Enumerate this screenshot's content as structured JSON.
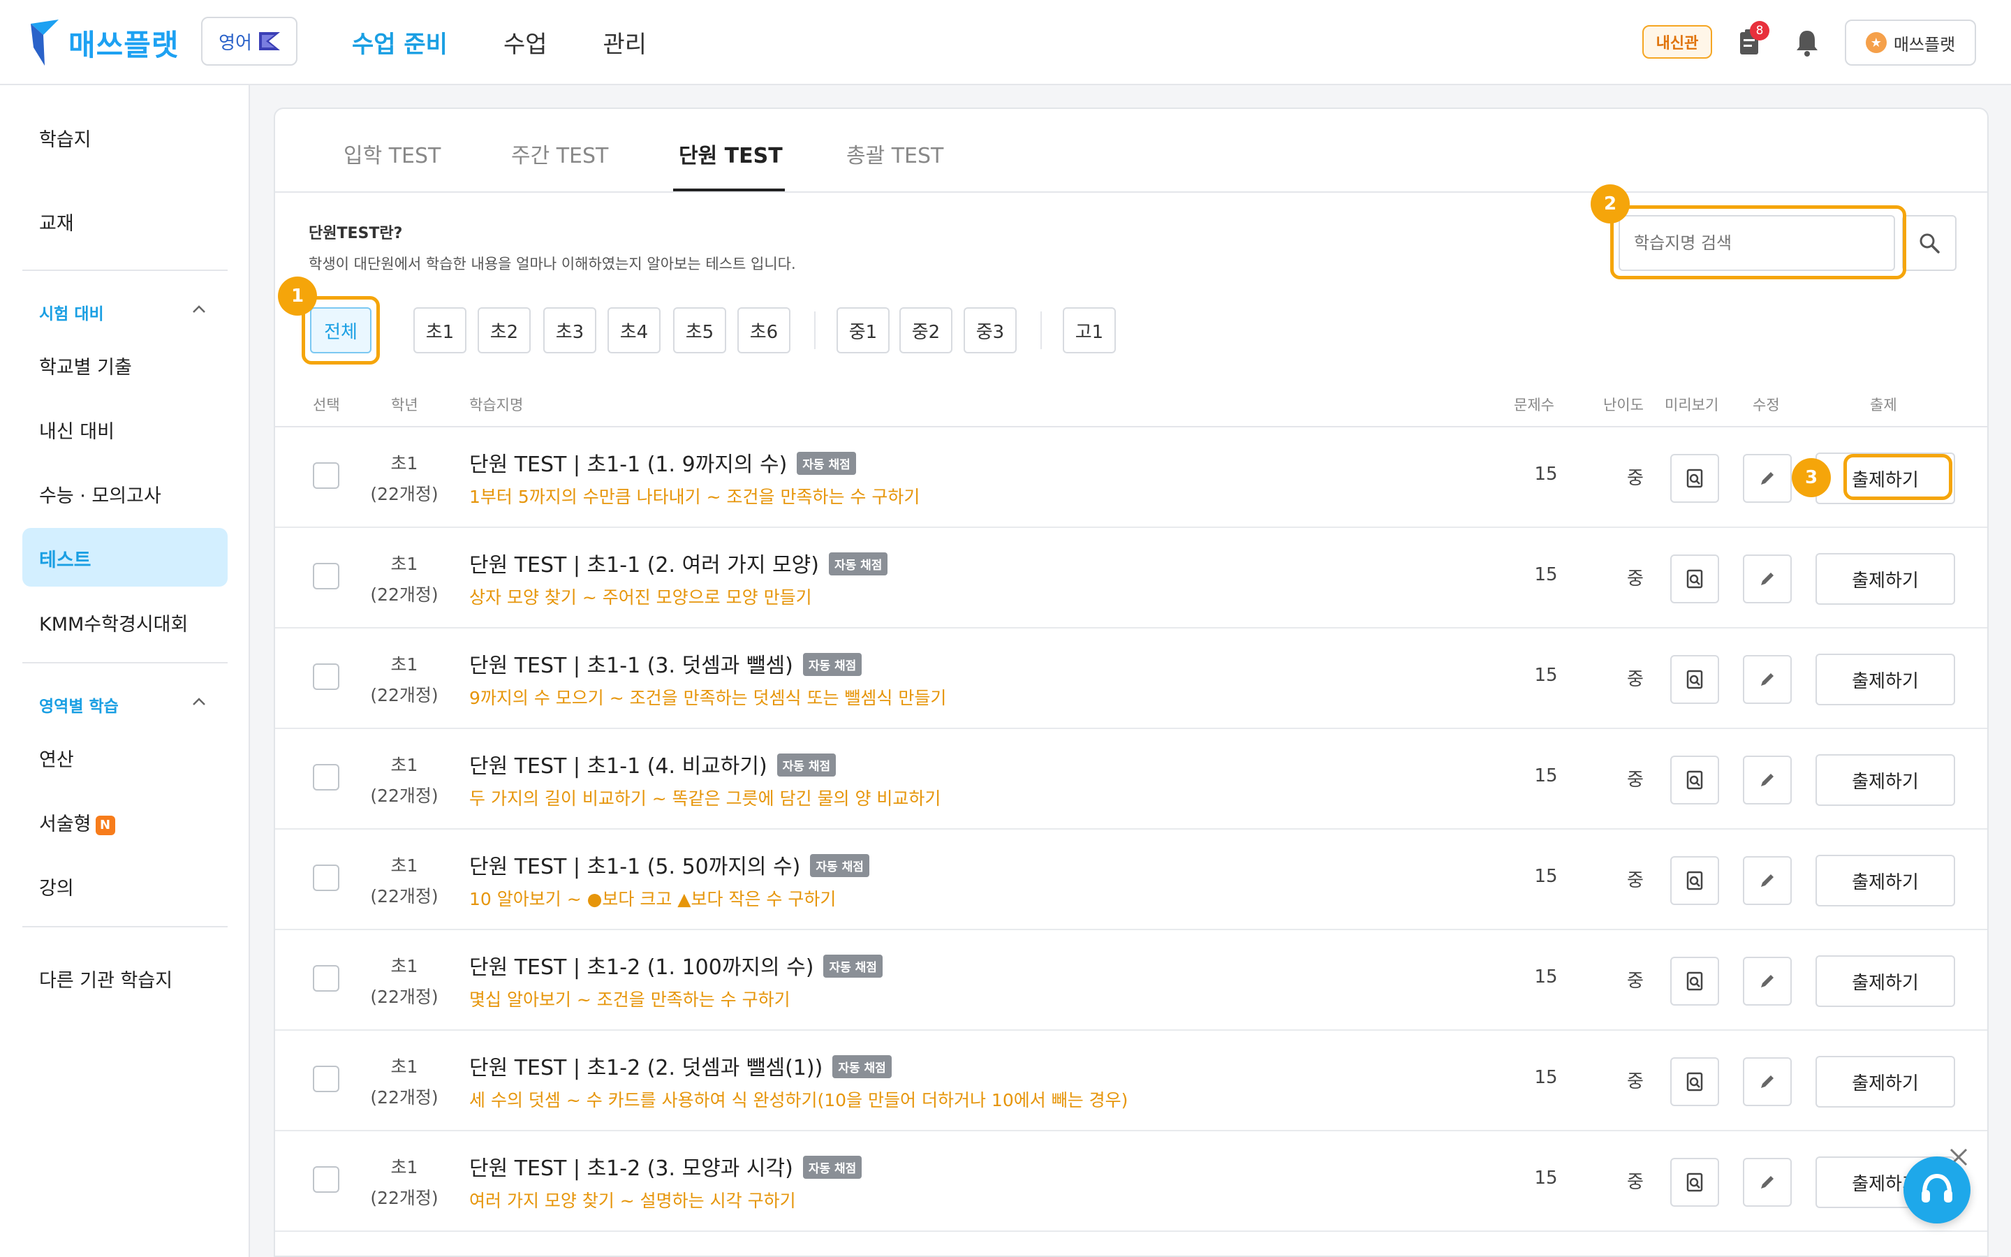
{
  "header": {
    "logo_text": "매쓰플랫",
    "language": "영어",
    "nav": [
      "수업 준비",
      "수업",
      "관리"
    ],
    "active_nav_index": 0,
    "school_badge": "내신관",
    "notification_count": "8",
    "user_name": "매쓰플랫"
  },
  "sidebar": {
    "items_top": [
      "학습지",
      "교재"
    ],
    "section_exam": "시험 대비",
    "exam_items": [
      "학교별 기출",
      "내신 대비",
      "수능 · 모의고사",
      "테스트",
      "KMM수학경시대회"
    ],
    "active_item": "테스트",
    "section_area": "영역별 학습",
    "area_items": [
      "연산",
      "서술형",
      "강의"
    ],
    "new_badge": "N",
    "other": "다른 기관 학습지"
  },
  "tabs": [
    "입학 TEST",
    "주간 TEST",
    "단원 TEST",
    "총괄 TEST"
  ],
  "active_tab": "단원 TEST",
  "description": {
    "title": "단원TEST란?",
    "body": "학생이 대단원에서 학습한 내용을 얼마나 이해하였는지 알아보는 테스트 입니다."
  },
  "search": {
    "placeholder": "학습지명 검색"
  },
  "filters": {
    "all": "전체",
    "elementary": [
      "초1",
      "초2",
      "초3",
      "초4",
      "초5",
      "초6"
    ],
    "middle": [
      "중1",
      "중2",
      "중3"
    ],
    "high": [
      "고1"
    ]
  },
  "steps": [
    "1",
    "2",
    "3"
  ],
  "table": {
    "headers": [
      "선택",
      "학년",
      "학습지명",
      "문제수",
      "난이도",
      "미리보기",
      "수정",
      "출제"
    ],
    "auto_tag": "자동 채점",
    "issue_label": "출제하기",
    "rows": [
      {
        "grade": "초1",
        "curriculum": "(22개정)",
        "title": "단원 TEST | 초1-1 (1. 9까지의 수)",
        "subtitle": "1부터 5까지의 수만큼 나타내기 ~ 조건을 만족하는 수 구하기",
        "count": "15",
        "difficulty": "중"
      },
      {
        "grade": "초1",
        "curriculum": "(22개정)",
        "title": "단원 TEST | 초1-1 (2. 여러 가지 모양)",
        "subtitle": "상자 모양 찾기 ~ 주어진 모양으로 모양 만들기",
        "count": "15",
        "difficulty": "중"
      },
      {
        "grade": "초1",
        "curriculum": "(22개정)",
        "title": "단원 TEST | 초1-1 (3. 덧셈과 뺄셈)",
        "subtitle": "9까지의 수 모으기 ~ 조건을 만족하는 덧셈식 또는 뺄셈식 만들기",
        "count": "15",
        "difficulty": "중"
      },
      {
        "grade": "초1",
        "curriculum": "(22개정)",
        "title": "단원 TEST | 초1-1 (4. 비교하기)",
        "subtitle": "두 가지의 길이 비교하기 ~ 똑같은 그릇에 담긴 물의 양 비교하기",
        "count": "15",
        "difficulty": "중"
      },
      {
        "grade": "초1",
        "curriculum": "(22개정)",
        "title": "단원 TEST | 초1-1 (5. 50까지의 수)",
        "subtitle": "10 알아보기 ~ ●보다 크고 ▲보다 작은 수 구하기",
        "count": "15",
        "difficulty": "중"
      },
      {
        "grade": "초1",
        "curriculum": "(22개정)",
        "title": "단원 TEST | 초1-2 (1. 100까지의 수)",
        "subtitle": "몇십 알아보기 ~ 조건을 만족하는 수 구하기",
        "count": "15",
        "difficulty": "중"
      },
      {
        "grade": "초1",
        "curriculum": "(22개정)",
        "title": "단원 TEST | 초1-2 (2. 덧셈과 뺄셈(1))",
        "subtitle": "세 수의 덧셈 ~ 수 카드를 사용하여 식 완성하기(10을 만들어 더하거나 10에서 빼는 경우)",
        "count": "15",
        "difficulty": "중"
      },
      {
        "grade": "초1",
        "curriculum": "(22개정)",
        "title": "단원 TEST | 초1-2 (3. 모양과 시각)",
        "subtitle": "여러 가지 모양 찾기 ~ 설명하는 시각 구하기",
        "count": "15",
        "difficulty": "중"
      }
    ]
  },
  "colors": {
    "accent": "#1a9fe3",
    "highlight": "#f5a50a",
    "subtitle": "#e6950a"
  }
}
